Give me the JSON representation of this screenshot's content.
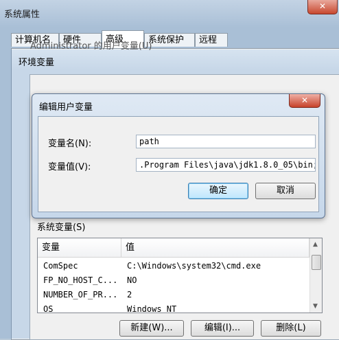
{
  "system_properties": {
    "title": "系统属性",
    "tabs": [
      {
        "label": "计算机名"
      },
      {
        "label": "硬件"
      },
      {
        "label": "高级"
      },
      {
        "label": "系统保护"
      },
      {
        "label": "远程"
      }
    ],
    "close_icon": "close-icon"
  },
  "env_vars": {
    "title": "环境变量",
    "user_vars_label": "Administrator 的用户变量(U)",
    "system_vars_label": "系统变量(S)",
    "table": {
      "columns": [
        "变量",
        "值"
      ],
      "rows": [
        {
          "name": "ComSpec",
          "value": "C:\\Windows\\system32\\cmd.exe"
        },
        {
          "name": "FP_NO_HOST_C...",
          "value": "NO"
        },
        {
          "name": "NUMBER_OF_PR...",
          "value": "2"
        },
        {
          "name": "OS",
          "value": "Windows_NT"
        }
      ]
    },
    "buttons": {
      "new": "新建(W)...",
      "edit": "编辑(I)...",
      "delete": "删除(L)"
    }
  },
  "edit_dialog": {
    "title": "编辑用户变量",
    "name_label": "变量名(N):",
    "name_value": "path",
    "value_label": "变量值(V):",
    "value_value": ".Program Files\\java\\jdk1.8.0_05\\bin;",
    "ok": "确定",
    "cancel": "取消"
  },
  "colors": {
    "close_button": "#c8482f",
    "dialog_frame": "#c6d7ea"
  }
}
